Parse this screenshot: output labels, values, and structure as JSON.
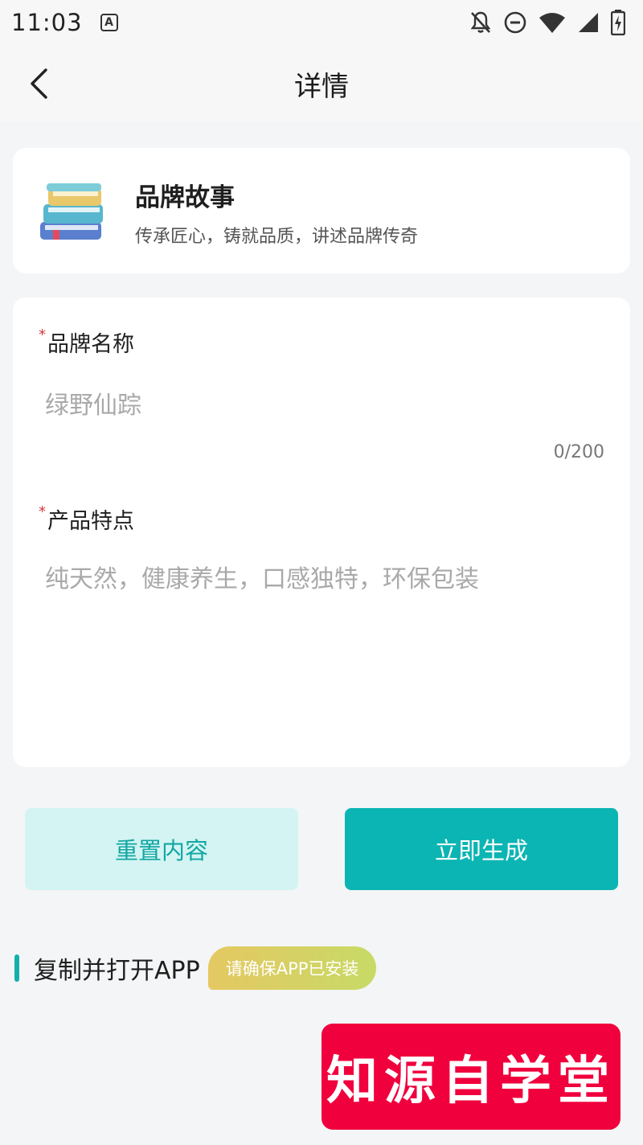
{
  "status_bar": {
    "time": "11:03",
    "badge": "A"
  },
  "nav": {
    "title": "详情"
  },
  "brand_card": {
    "title": "品牌故事",
    "subtitle": "传承匠心，铸就品质，讲述品牌传奇"
  },
  "form": {
    "brand_name_label": "品牌名称",
    "brand_name_placeholder": "绿野仙踪",
    "brand_name_value": "",
    "counter": "0/200",
    "feature_label": "产品特点",
    "feature_placeholder": "纯天然，健康养生，口感独特，环保包装",
    "feature_value": "",
    "required_mark": "*"
  },
  "buttons": {
    "reset": "重置内容",
    "generate": "立即生成"
  },
  "copy_section": {
    "label": "复制并打开APP",
    "badge": "请确保APP已安装"
  },
  "watermark": {
    "text": "知源自学堂"
  },
  "colors": {
    "accent": "#0bb5b3",
    "accent_light": "#d3f4f2",
    "required": "#d4393b",
    "watermark": "#f0003d"
  }
}
